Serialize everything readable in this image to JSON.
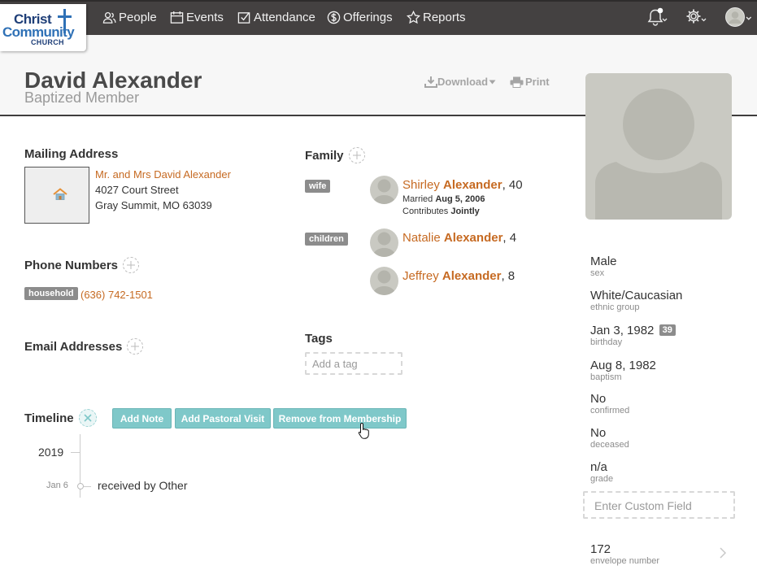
{
  "logo": {
    "line1": "Christ",
    "line2": "Community",
    "line3": "CHURCH"
  },
  "nav": [
    {
      "label": "People",
      "icon": "people-icon"
    },
    {
      "label": "Events",
      "icon": "calendar-icon"
    },
    {
      "label": "Attendance",
      "icon": "checkbox-icon"
    },
    {
      "label": "Offerings",
      "icon": "dollar-icon"
    },
    {
      "label": "Reports",
      "icon": "star-icon"
    }
  ],
  "header": {
    "name": "David Alexander",
    "status": "Baptized Member",
    "download_label": "Download",
    "print_label": "Print"
  },
  "mailing": {
    "title": "Mailing Address",
    "line1": "Mr. and Mrs David Alexander",
    "line2": "4027 Court Street",
    "line3": "Gray Summit, MO   63039"
  },
  "phones": {
    "title": "Phone Numbers",
    "items": [
      {
        "type": "household",
        "number": "(636) 742-1501"
      }
    ]
  },
  "emails": {
    "title": "Email Addresses"
  },
  "family": {
    "title": "Family",
    "wife_label": "wife",
    "children_label": "children",
    "wife": {
      "first": "Shirley",
      "last": "Alexander",
      "age": ", 40",
      "married_prefix": "Married",
      "married_date": "Aug 5, 2006",
      "contrib_prefix": "Contributes",
      "contrib_value": "Jointly"
    },
    "children": [
      {
        "first": "Natalie",
        "last": "Alexander",
        "age": ", 4"
      },
      {
        "first": "Jeffrey",
        "last": "Alexander",
        "age": ", 8"
      }
    ]
  },
  "tags": {
    "title": "Tags",
    "placeholder": "Add a tag"
  },
  "timeline": {
    "title": "Timeline",
    "buttons": [
      "Add Note",
      "Add Pastoral Visit",
      "Remove from Membership"
    ],
    "year": "2019",
    "entries": [
      {
        "date": "Jan 6",
        "text": "received by Other"
      }
    ]
  },
  "facts": [
    {
      "value": "Male",
      "label": "sex"
    },
    {
      "value": "White/Caucasian",
      "label": "ethnic group"
    },
    {
      "value": "Jan 3, 1982",
      "label": "birthday",
      "badge": "39"
    },
    {
      "value": "Aug 8, 1982",
      "label": "baptism"
    },
    {
      "value": "No",
      "label": "confirmed"
    },
    {
      "value": "No",
      "label": "deceased"
    },
    {
      "value": "n/a",
      "label": "grade"
    }
  ],
  "custom_field": {
    "placeholder": "Enter Custom Field"
  },
  "envelope": {
    "value": "172",
    "label": "envelope number"
  },
  "colors": {
    "accent": "#c66a22",
    "teal": "#7fc8c9",
    "topbar": "#444141"
  }
}
